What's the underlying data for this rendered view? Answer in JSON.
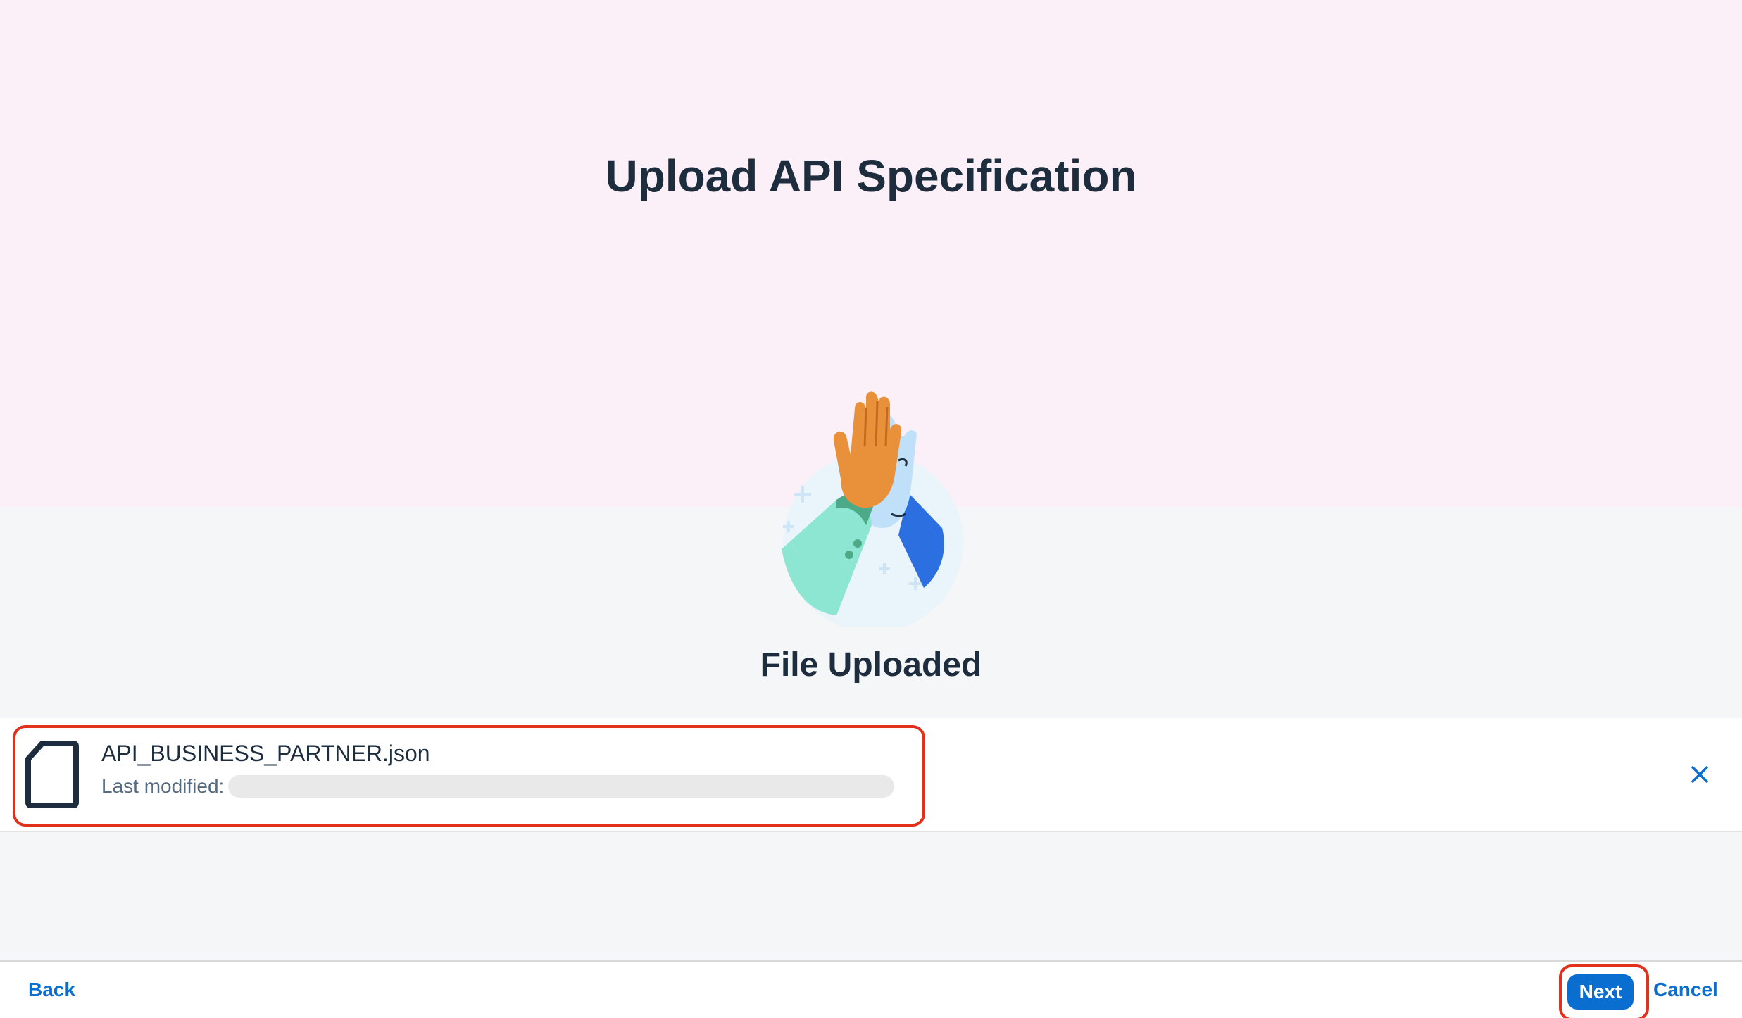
{
  "header": {
    "title": "Upload API Specification"
  },
  "illustration": {
    "icon": "high-five-illustration",
    "colors": {
      "circle": "#eaf4fb",
      "orange_hand": "#e8913a",
      "blue_hand": "#bfe0f8",
      "blue_sleeve": "#2b6fe0",
      "green_sleeve": "#8de6d1",
      "green_cuff": "#4daa88"
    }
  },
  "status": {
    "message": "File Uploaded"
  },
  "file": {
    "icon": "document-icon",
    "name": "API_BUSINESS_PARTNER.json",
    "last_modified_label": "Last modified:",
    "remove_icon": "close-icon"
  },
  "footer": {
    "back_label": "Back",
    "next_label": "Next",
    "cancel_label": "Cancel"
  },
  "theme": {
    "accent": "#0a6ed1",
    "highlight": "#e2301b",
    "hero_background": "#fbf0f8",
    "text": "#1d2d3e"
  }
}
